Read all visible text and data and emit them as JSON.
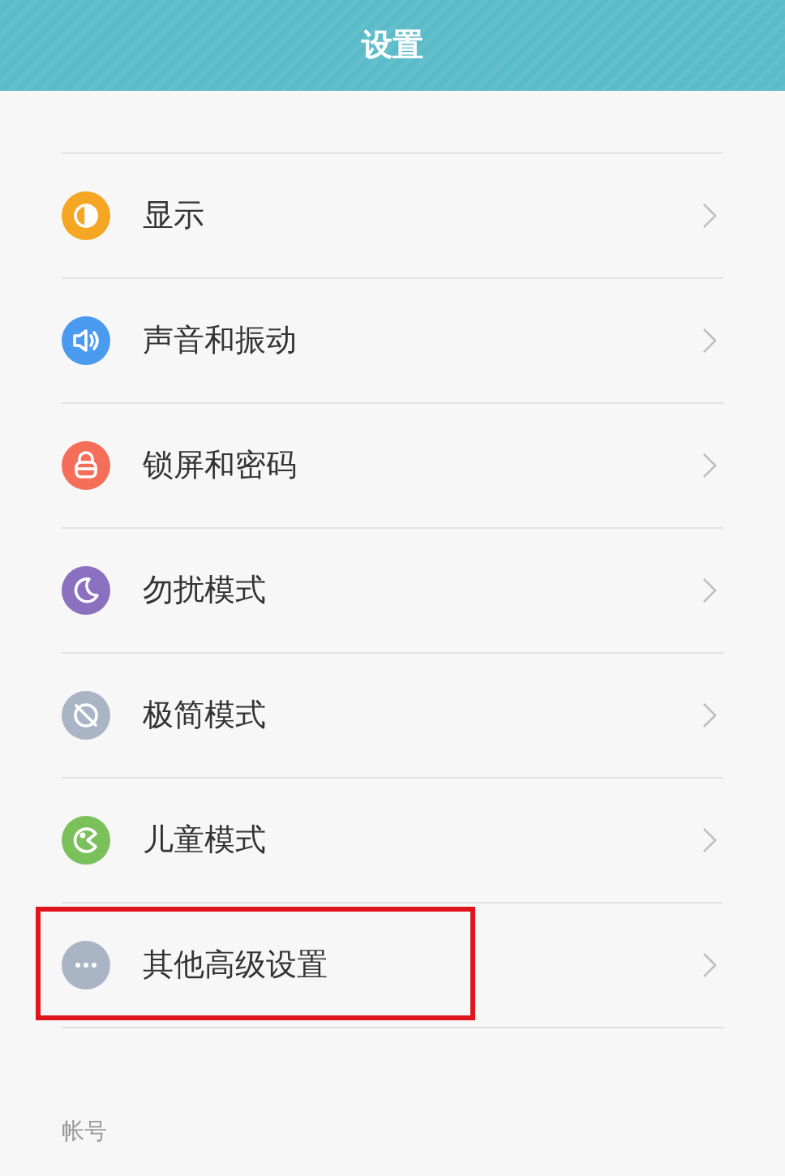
{
  "header": {
    "title": "设置"
  },
  "settings": [
    {
      "kind": "display",
      "color": "#f5a623",
      "label": "显示",
      "highlighted": false
    },
    {
      "kind": "sound",
      "color": "#4a9af0",
      "label": "声音和振动",
      "highlighted": false
    },
    {
      "kind": "lock",
      "color": "#f46e5a",
      "label": "锁屏和密码",
      "highlighted": false
    },
    {
      "kind": "moon",
      "color": "#8c70c0",
      "label": "勿扰模式",
      "highlighted": false
    },
    {
      "kind": "minimal",
      "color": "#a9b5c4",
      "label": "极简模式",
      "highlighted": false
    },
    {
      "kind": "kids",
      "color": "#7bc15b",
      "label": "儿童模式",
      "highlighted": false
    },
    {
      "kind": "more",
      "color": "#a9b5c4",
      "label": "其他高级设置",
      "highlighted": true
    }
  ],
  "section": {
    "title": "帐号"
  }
}
